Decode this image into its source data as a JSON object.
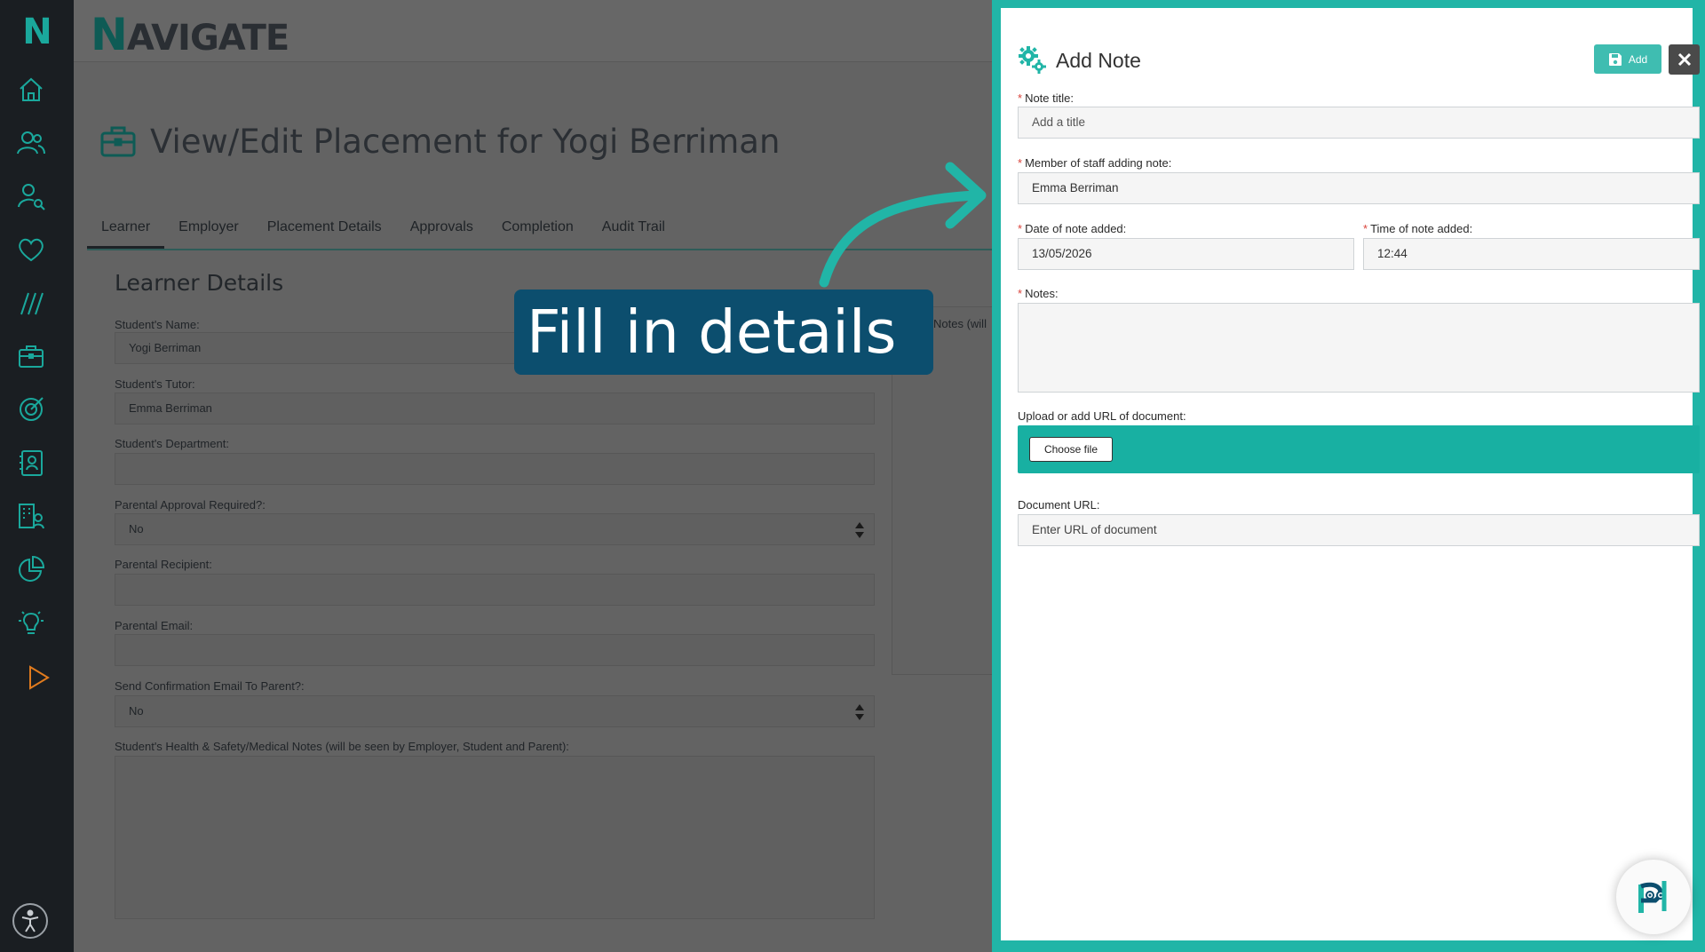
{
  "sidebar": {
    "logo": "N",
    "icons": [
      "home-icon",
      "users-icon",
      "user-search-icon",
      "heart-icon",
      "slashes-icon",
      "briefcase-icon",
      "target-icon",
      "contact-card-icon",
      "building-user-icon",
      "pie-chart-icon",
      "lightbulb-icon",
      "play-icon",
      "accessibility-icon"
    ]
  },
  "app": {
    "brand_first": "N",
    "brand_rest": "AVIGATE",
    "page_title": "View/Edit Placement for Yogi Berriman",
    "tabs": [
      "Learner",
      "Employer",
      "Placement Details",
      "Approvals",
      "Completion",
      "Audit Trail"
    ],
    "active_tab": "Learner",
    "section_title": "Learner Details",
    "fields": {
      "student_name_label": "Student's Name:",
      "student_name_value": "Yogi Berriman",
      "student_tutor_label": "Student's Tutor:",
      "student_tutor_value": "Emma Berriman",
      "student_department_label": "Student's Department:",
      "student_department_value": "",
      "parental_approval_label": "Parental Approval Required?:",
      "parental_approval_value": "No",
      "parental_recipient_label": "Parental Recipient:",
      "parental_recipient_value": "",
      "parental_email_label": "Parental Email:",
      "parental_email_value": "",
      "send_confirmation_label": "Send Confirmation Email To Parent?:",
      "send_confirmation_value": "No",
      "health_notes_label": "Student's Health & Safety/Medical Notes (will be seen by Employer, Student and Parent):",
      "side_notes_label": "Notes (will"
    }
  },
  "drawer": {
    "title": "Add Note",
    "add_button": "Add",
    "required_marker": "*",
    "note_title_label": "Note title:",
    "note_title_placeholder": "Add a title",
    "staff_label": "Member of staff adding note:",
    "staff_value": "Emma Berriman",
    "date_label": "Date of note added:",
    "date_value": "13/05/2026",
    "time_label": "Time of note added:",
    "time_value": "12:44",
    "notes_label": "Notes:",
    "notes_value": "",
    "upload_label": "Upload or add URL of document:",
    "choose_file_button": "Choose file",
    "doc_url_label": "Document URL:",
    "doc_url_placeholder": "Enter URL of document"
  },
  "callout": {
    "text": "Fill in details"
  },
  "colors": {
    "accent": "#21b5a7",
    "callout_bg": "#0c4e6e",
    "sidebar_bg": "#1a1e22",
    "required": "#d9433b"
  }
}
